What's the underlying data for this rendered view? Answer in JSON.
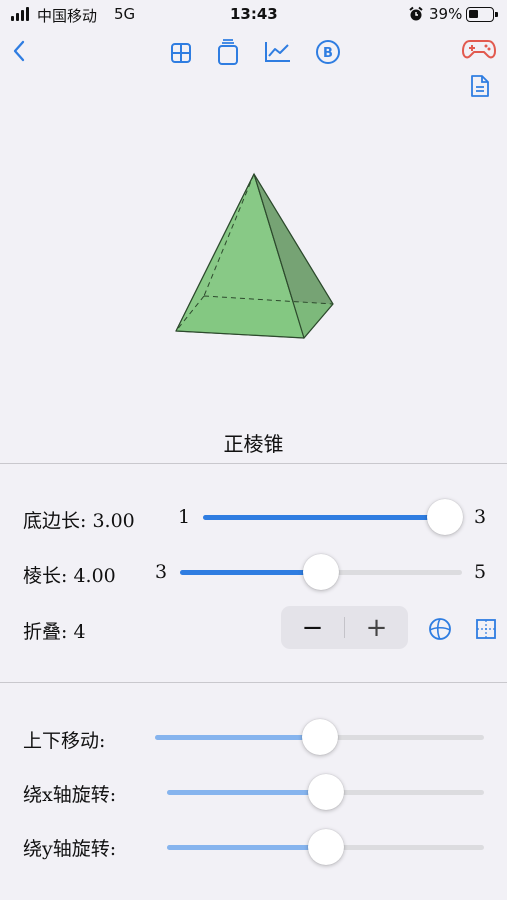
{
  "status_bar": {
    "carrier": "中国移动",
    "network": "5G",
    "time": "13:43",
    "battery": "39%"
  },
  "toolbar": {
    "icons": [
      "back-icon",
      "grid-icon",
      "cylinder-icon",
      "line-chart-icon",
      "b-circle-icon",
      "gamepad-icon",
      "document-icon"
    ]
  },
  "canvas": {
    "title": "正棱锥",
    "shape_fill": "#7cc47a",
    "edge_color": "#2d4a2d"
  },
  "params": {
    "base_edge": {
      "label": "底边长: 3.00",
      "min": "1",
      "max": "3",
      "value": 1.0
    },
    "edge": {
      "label": "棱长: 4.00",
      "min": "3",
      "max": "5",
      "value": 0.5
    },
    "fold": {
      "label": "折叠: 4",
      "minus": "−",
      "plus": "+"
    }
  },
  "transform": {
    "move": {
      "label": "上下移动:",
      "value": 0.5
    },
    "rot_x": {
      "label": "绕x轴旋转:",
      "value": 0.5
    },
    "rot_y": {
      "label": "绕y轴旋转:",
      "value": 0.5
    }
  },
  "colors": {
    "accent": "#2f7de1",
    "accent_light": "#86b4ee",
    "game_icon": "#e25a4f"
  }
}
